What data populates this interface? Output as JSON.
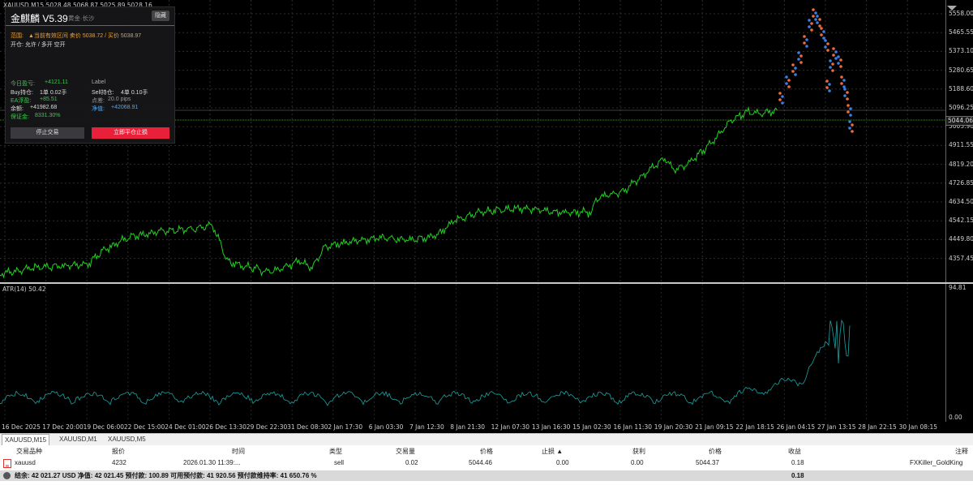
{
  "chart": {
    "symbol_line": "XAUUSD,M15  5028.48 5068.87 5025.89 5028.16",
    "price_labels": [
      "5558.00",
      "5465.55",
      "5373.10",
      "5280.65",
      "5188.60",
      "5096.25",
      "5003.90",
      "4911.55",
      "4819.20",
      "4726.85",
      "4634.50",
      "4542.15",
      "4449.80",
      "4357.45"
    ],
    "current_price": "5044.06",
    "line_color": "#22d022",
    "atr_title": "ATR(14) 50.42",
    "atr_labels": [
      "94.81",
      "0.00"
    ],
    "atr_color": "#1aa3a3",
    "time_labels": [
      "16 Dec 2025",
      "17 Dec 20:00",
      "19 Dec 06:00",
      "22 Dec 15:00",
      "24 Dec 01:00",
      "26 Dec 13:30",
      "29 Dec 22:30",
      "31 Dec 08:30",
      "2 Jan 17:30",
      "6 Jan 03:30",
      "7 Jan 12:30",
      "8 Jan 21:30",
      "12 Jan 07:30",
      "13 Jan 16:30",
      "15 Jan 02:30",
      "16 Jan 11:30",
      "19 Jan 20:30",
      "21 Jan 09:15",
      "22 Jan 18:15",
      "26 Jan 04:15",
      "27 Jan 13:15",
      "28 Jan 22:15",
      "30 Jan 08:15"
    ]
  },
  "ea_panel": {
    "title": "金麒麟 V5.39",
    "subtitle": "黄金·长沙",
    "hide_button": "隐藏",
    "row1_label": "范围:",
    "row1_value": "▲当前有效区间 卖价 5038.72 / 买价 5038.97",
    "row2": "开仓:  允许  /  多开  空开",
    "floating_label": "今日盈亏:",
    "floating_value": "+4121.11",
    "label_text": "Label",
    "buy_label": "Buy持仓:",
    "buy_value": "1单  0.02手",
    "sell_label": "Sell持仓:",
    "sell_value": "4单  0.10手",
    "ea_profit_label": "EA浮盈:",
    "ea_profit_value": "+85.51",
    "spread_label": "点差:",
    "spread_value": "20.0 pips",
    "balance_label": "余额:",
    "balance_value": "+41982.68",
    "equity_label": "净值:",
    "equity_value": "+42068.91",
    "margin_label": "保证金:",
    "margin_value": "8331.30%",
    "stop_button": "停止交易",
    "close_button": "立即平仓止损"
  },
  "tabs": [
    "XAUUSD,M15",
    "XAUUSD,M1",
    "XAUUSD,M5"
  ],
  "terminal": {
    "headers": [
      "交易品种",
      "报价",
      "时间",
      "类型",
      "交易量",
      "价格",
      "止损 ▲",
      "获利",
      "价格",
      "收益",
      "注释"
    ],
    "row": {
      "symbol": "xauusd",
      "ticket": "4232",
      "time": "2026.01.30 11:39:...",
      "type": "sell",
      "volume": "0.02",
      "open_price": "5044.46",
      "sl": "0.00",
      "tp": "0.00",
      "price": "5044.37",
      "profit": "0.18",
      "comment": "FXKiller_GoldKing"
    },
    "summary": "结余: 42 021.27 USD  净值: 42 021.45  预付款: 100.89  可用预付款: 41 920.56  预付款维持率: 41 650.76 %",
    "summary_profit": "0.18"
  }
}
